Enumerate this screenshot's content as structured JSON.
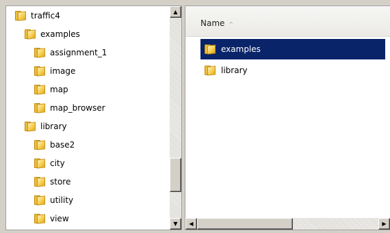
{
  "tree": {
    "items": [
      {
        "label": "traffic4"
      },
      {
        "label": "examples"
      },
      {
        "label": "assignment_1"
      },
      {
        "label": "image"
      },
      {
        "label": "map"
      },
      {
        "label": "map_browser"
      },
      {
        "label": "library"
      },
      {
        "label": "base2"
      },
      {
        "label": "city"
      },
      {
        "label": "store"
      },
      {
        "label": "utility"
      },
      {
        "label": "view"
      }
    ],
    "scroll_up_glyph": "▲",
    "scroll_down_glyph": "▼"
  },
  "list": {
    "column_header": "Name",
    "sort_glyph": "^",
    "sort_direction": "ascending",
    "items": [
      {
        "label": "examples",
        "selected": true
      },
      {
        "label": "library",
        "selected": false
      }
    ],
    "scroll_left_glyph": "◀",
    "scroll_right_glyph": "▶"
  },
  "colors": {
    "selection": "#0a246a",
    "window_face": "#d4d0c8",
    "folder": "#f0c040"
  },
  "icons": {
    "folder": "folder-icon"
  }
}
